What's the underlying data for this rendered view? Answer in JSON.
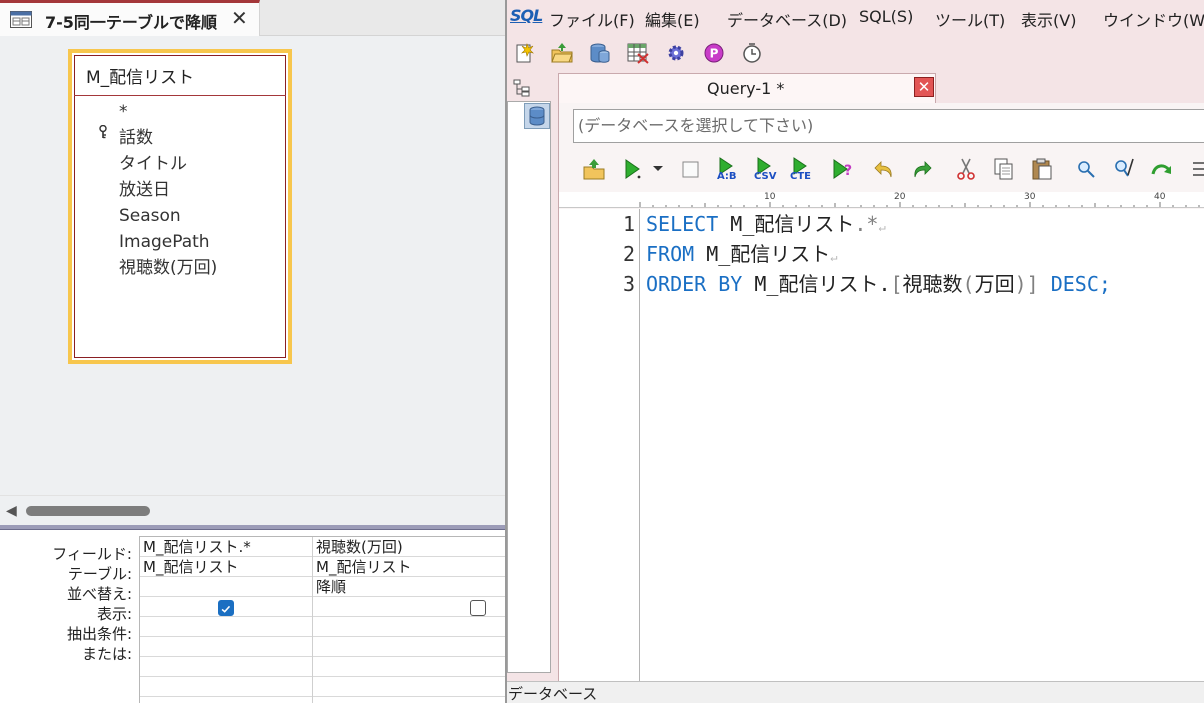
{
  "access": {
    "tab": {
      "title": "7-5同一テーブルで降順",
      "close": "✕"
    },
    "table": {
      "name": "M_配信リスト",
      "fields": [
        "*",
        "話数",
        "タイトル",
        "放送日",
        "Season",
        "ImagePath",
        "視聴数(万回)"
      ],
      "key_field": "話数"
    },
    "grid": {
      "row_labels": [
        "フィールド:",
        "テーブル:",
        "並べ替え:",
        "表示:",
        "抽出条件:",
        "または:"
      ],
      "columns": [
        {
          "field": "M_配信リスト.*",
          "table": "M_配信リスト",
          "sort": "",
          "show": true
        },
        {
          "field": "視聴数(万回)",
          "table": "M_配信リスト",
          "sort": "降順",
          "show": false
        }
      ]
    }
  },
  "sql_tool": {
    "logo": "SQL",
    "menu": [
      "ファイル(F)",
      "編集(E)",
      "データベース(D)",
      "SQL(S)",
      "ツール(T)",
      "表示(V)",
      "ウインドウ(W)"
    ],
    "query_tab": {
      "title": "Query-1 *",
      "close": "✕"
    },
    "db_placeholder": "(データベースを選択して下さい)",
    "toolbar2_labels": {
      "ab": "A:B",
      "csv": "CSV",
      "cte": "CTE",
      "q": "?"
    },
    "ruler_marks": [
      "10",
      "20",
      "30",
      "40"
    ],
    "line_numbers": [
      "1",
      "2",
      "3"
    ],
    "code": {
      "line1": {
        "kw": "SELECT",
        "ident": " M_配信リスト",
        "star": ".*"
      },
      "line2": {
        "kw": "FROM",
        "ident": " M_配信リスト"
      },
      "line3": {
        "kw1": "ORDER BY",
        "ident": " M_配信リスト.",
        "lb": "[",
        "col": "視聴数",
        "lp": "(",
        "unit": "万回",
        "rp": ")",
        "rb": "]",
        "kw2": " DESC",
        "semi": ";"
      },
      "eol": "↵"
    },
    "status": "データベース"
  },
  "colors": {
    "accent": "#a4373a",
    "highlight": "#f7c64d",
    "keyword": "#1a6fc4",
    "check": "#1b6fc2"
  }
}
